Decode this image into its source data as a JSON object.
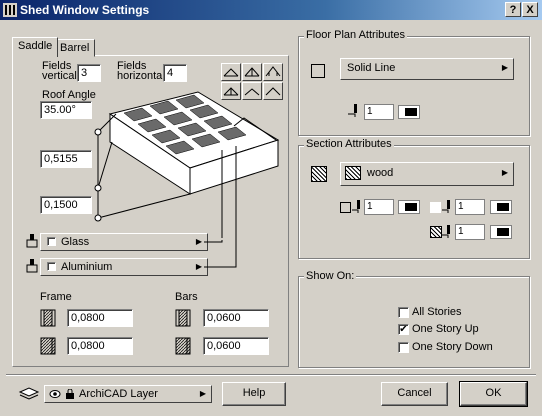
{
  "window": {
    "title": "Shed Window Settings",
    "help_btn": "?",
    "close_btn": "X"
  },
  "tabs": [
    {
      "label": "Saddle"
    },
    {
      "label": "Barrel"
    }
  ],
  "saddle": {
    "fields_vertical_label_1": "Fields",
    "fields_vertical_label_2": "vertical",
    "fields_vertical_value": "3",
    "fields_horizontal_label_1": "Fields",
    "fields_horizontal_label_2": "horizontal",
    "fields_horizontal_value": "4",
    "roof_angle_label": "Roof  Angle",
    "roof_angle_value": "35.00°",
    "height_upper_value": "0,5155",
    "height_lower_value": "0,1500",
    "glass_label": "Glass",
    "aluminium_label": "Aluminium"
  },
  "frame": {
    "label": "Frame",
    "value_1": "0,0800",
    "value_2": "0,0800"
  },
  "bars": {
    "label": "Bars",
    "value_1": "0,0600",
    "value_2": "0,0600"
  },
  "floor_plan": {
    "group_label": "Floor Plan Attributes",
    "line_type": "Solid Line",
    "pen_value": "1"
  },
  "section": {
    "group_label": "Section Attributes",
    "material": "wood",
    "pen_1": "1",
    "pen_2": "1",
    "pen_3": "1"
  },
  "show_on": {
    "group_label": "Show On:",
    "options": [
      {
        "label": "All Stories",
        "checked": false,
        "mark": ""
      },
      {
        "label": "One Story Up",
        "checked": true,
        "mark": "✔"
      },
      {
        "label": "One Story Down",
        "checked": false,
        "mark": ""
      }
    ]
  },
  "footer": {
    "layer": "ArchiCAD Layer",
    "help": "Help",
    "cancel": "Cancel",
    "ok": "OK"
  }
}
